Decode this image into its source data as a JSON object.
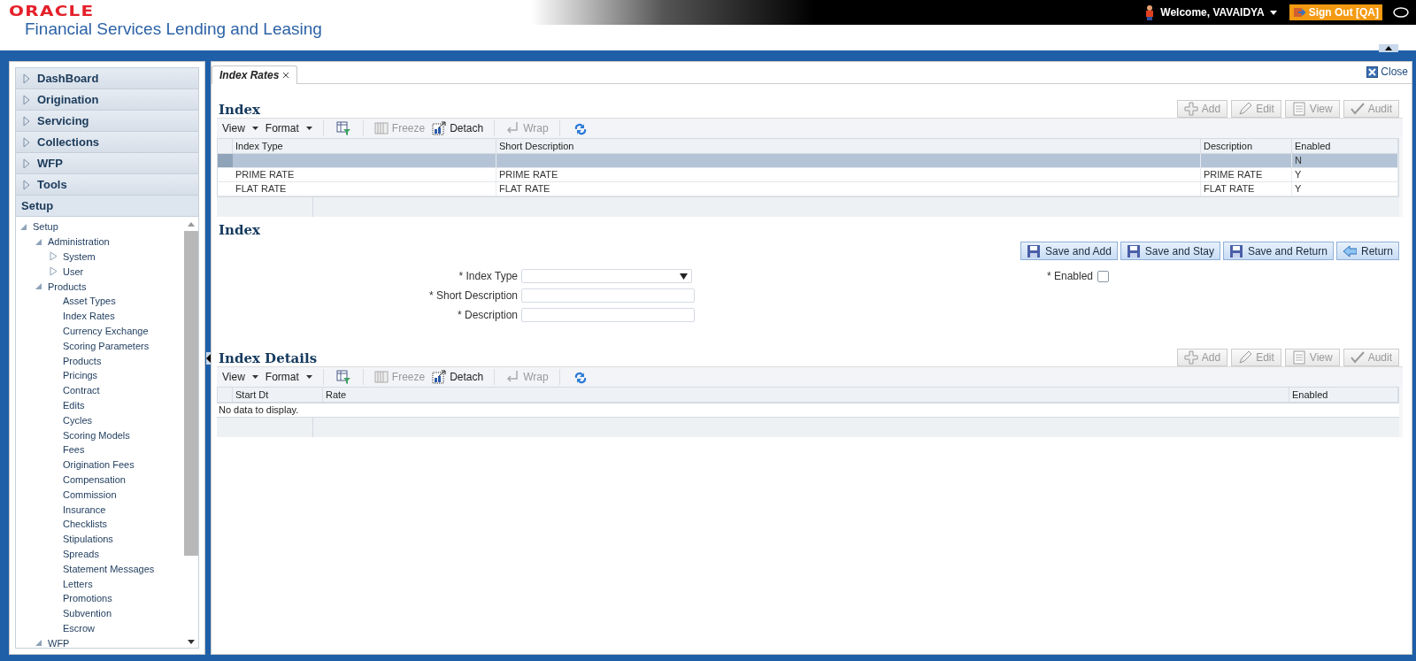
{
  "header": {
    "logo": "ORACLE",
    "product": "Financial Services Lending and Leasing",
    "welcome": "Welcome, VAVAIDYA",
    "sign_out": "Sign Out [QA]"
  },
  "accordion": [
    {
      "label": "DashBoard",
      "expanded": false
    },
    {
      "label": "Origination",
      "expanded": false
    },
    {
      "label": "Servicing",
      "expanded": false
    },
    {
      "label": "Collections",
      "expanded": false
    },
    {
      "label": "WFP",
      "expanded": false
    },
    {
      "label": "Tools",
      "expanded": false
    },
    {
      "label": "Setup",
      "expanded": true
    }
  ],
  "tree": [
    {
      "label": "Setup",
      "expanded": true,
      "children": [
        {
          "label": "Administration",
          "expanded": true,
          "children": [
            {
              "label": "System",
              "expanded": false
            },
            {
              "label": "User",
              "expanded": false
            }
          ]
        },
        {
          "label": "Products",
          "expanded": true,
          "children": [
            {
              "label": "Asset Types"
            },
            {
              "label": "Index Rates"
            },
            {
              "label": "Currency Exchange"
            },
            {
              "label": "Scoring Parameters"
            },
            {
              "label": "Products"
            },
            {
              "label": "Pricings"
            },
            {
              "label": "Contract"
            },
            {
              "label": "Edits"
            },
            {
              "label": "Cycles"
            },
            {
              "label": "Scoring Models"
            },
            {
              "label": "Fees"
            },
            {
              "label": "Origination Fees"
            },
            {
              "label": "Compensation"
            },
            {
              "label": "Commission"
            },
            {
              "label": "Insurance"
            },
            {
              "label": "Checklists"
            },
            {
              "label": "Stipulations"
            },
            {
              "label": "Spreads"
            },
            {
              "label": "Statement Messages"
            },
            {
              "label": "Letters"
            },
            {
              "label": "Promotions"
            },
            {
              "label": "Subvention"
            },
            {
              "label": "Escrow"
            }
          ]
        },
        {
          "label": "WFP",
          "expanded": true
        }
      ]
    }
  ],
  "tabs": [
    {
      "label": "Index Rates",
      "selected": true
    }
  ],
  "close": "Close",
  "index_table": {
    "title": "Index",
    "actions": [
      {
        "kind": "add",
        "label": "Add",
        "disabled": true
      },
      {
        "kind": "edit",
        "label": "Edit",
        "disabled": true
      },
      {
        "kind": "view",
        "label": "View",
        "disabled": true
      },
      {
        "kind": "audit",
        "label": "Audit",
        "disabled": true
      }
    ],
    "toolbar": [
      {
        "kind": "menu",
        "label": "View"
      },
      {
        "kind": "menu",
        "label": "Format"
      },
      {
        "kind": "filter"
      },
      {
        "kind": "freeze",
        "label": "Freeze",
        "disabled": true
      },
      {
        "kind": "detach",
        "label": "Detach",
        "disabled": false
      },
      {
        "kind": "wrap",
        "label": "Wrap",
        "disabled": true
      },
      {
        "kind": "refresh"
      }
    ],
    "columns": [
      "Index Type",
      "Short Description",
      "Description",
      "Enabled"
    ],
    "rows": [
      {
        "cells": [
          "",
          "",
          "",
          "N"
        ],
        "selected": true
      },
      {
        "cells": [
          "PRIME RATE",
          "PRIME RATE",
          "PRIME RATE",
          "Y"
        ],
        "selected": false
      },
      {
        "cells": [
          "FLAT RATE",
          "FLAT RATE",
          "FLAT RATE",
          "Y"
        ],
        "selected": false
      }
    ]
  },
  "index_form": {
    "title": "Index",
    "buttons": [
      {
        "kind": "save",
        "label": "Save and Add"
      },
      {
        "kind": "save",
        "label": "Save and Stay"
      },
      {
        "kind": "save",
        "label": "Save and Return"
      },
      {
        "kind": "return",
        "label": "Return"
      }
    ],
    "fields": [
      {
        "kind": "select",
        "label": "* Index Type"
      },
      {
        "kind": "text",
        "label": "* Short Description"
      },
      {
        "kind": "text",
        "label": "* Description"
      }
    ],
    "enabled": {
      "label": "* Enabled",
      "checked": false
    }
  },
  "details_table": {
    "title": "Index Details",
    "actions": [
      {
        "kind": "add",
        "label": "Add",
        "disabled": true
      },
      {
        "kind": "edit",
        "label": "Edit",
        "disabled": true
      },
      {
        "kind": "view",
        "label": "View",
        "disabled": true
      },
      {
        "kind": "audit",
        "label": "Audit",
        "disabled": true
      }
    ],
    "toolbar": [
      {
        "kind": "menu",
        "label": "View"
      },
      {
        "kind": "menu",
        "label": "Format"
      },
      {
        "kind": "filter"
      },
      {
        "kind": "freeze",
        "label": "Freeze",
        "disabled": true
      },
      {
        "kind": "detach",
        "label": "Detach",
        "disabled": false
      },
      {
        "kind": "wrap",
        "label": "Wrap",
        "disabled": true
      },
      {
        "kind": "refresh"
      }
    ],
    "columns": [
      "Start Dt",
      "Rate",
      "Enabled"
    ],
    "empty": "No data to display."
  }
}
